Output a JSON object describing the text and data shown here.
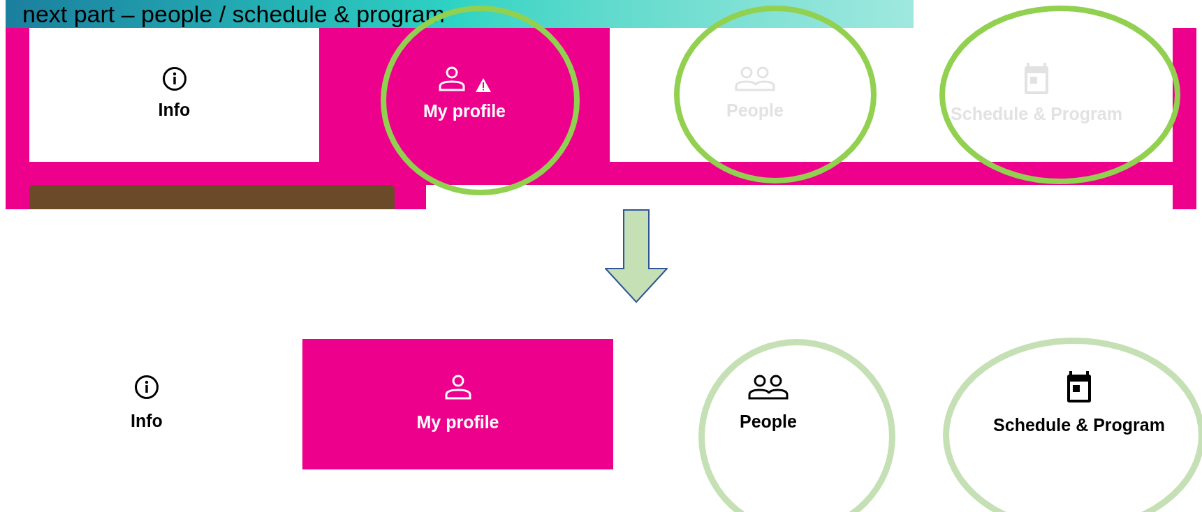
{
  "heading": "next part – people / schedule & program",
  "before": {
    "tabs": [
      {
        "label": "Info",
        "selected": false,
        "disabled": false,
        "warning": false
      },
      {
        "label": "My profile",
        "selected": true,
        "disabled": false,
        "warning": true
      },
      {
        "label": "People",
        "selected": false,
        "disabled": true,
        "warning": false
      },
      {
        "label": "Schedule & Program",
        "selected": false,
        "disabled": true,
        "warning": false
      }
    ]
  },
  "after": {
    "tabs": [
      {
        "label": "Info",
        "selected": false,
        "disabled": false
      },
      {
        "label": "My profile",
        "selected": true,
        "disabled": false
      },
      {
        "label": "People",
        "selected": false,
        "disabled": false
      },
      {
        "label": "Schedule & Program",
        "selected": false,
        "disabled": false
      }
    ]
  }
}
